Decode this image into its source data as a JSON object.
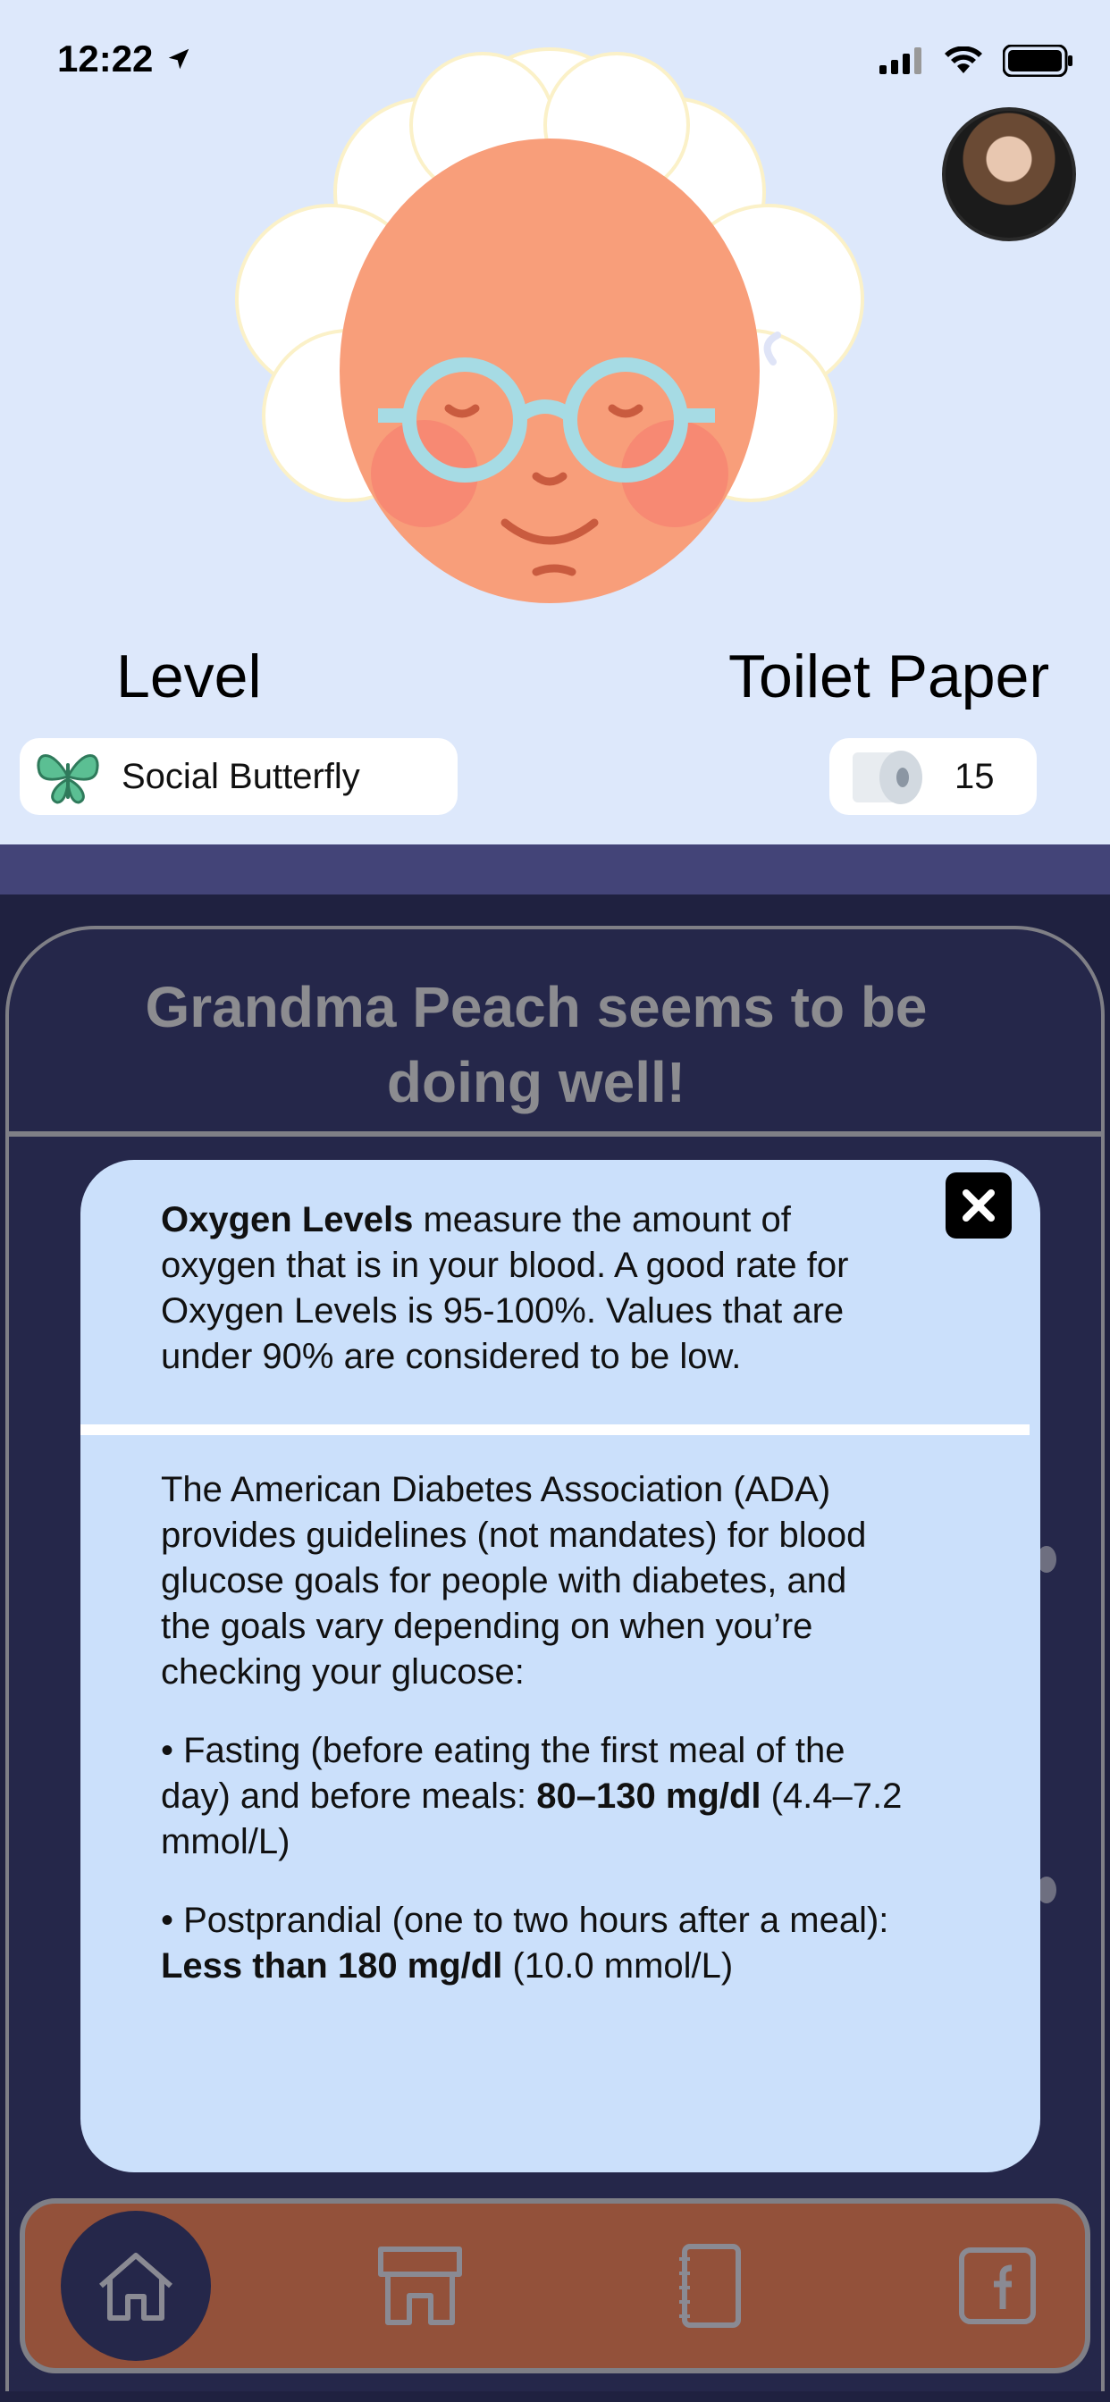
{
  "status_bar": {
    "time": "12:22",
    "icons": [
      "location-arrow-icon",
      "signal-icon",
      "wifi-icon",
      "battery-icon"
    ]
  },
  "profile": {
    "level_heading": "Level",
    "level_name": "Social Butterfly",
    "level_icon": "butterfly-icon",
    "toilet_heading": "Toilet Paper",
    "toilet_count": "15",
    "toilet_icon": "toilet-paper-icon"
  },
  "card": {
    "title_line1": "Grandma Peach seems to be",
    "title_line2": "doing well!"
  },
  "modal": {
    "oxygen_bold": "Oxygen Levels",
    "oxygen_line1_rest": " measure the amount of",
    "oxygen_line2": "oxygen that is in your blood.  A good rate for",
    "oxygen_line3": "Oxygen Levels is 95-100%.  Values that are",
    "oxygen_line4": "under 90% are considered to be low.",
    "ada_line1": "The American Diabetes Association (ADA)",
    "ada_line2": "provides guidelines (not mandates) for blood",
    "ada_line3": "glucose goals for people with diabetes, and",
    "ada_line4": "the goals vary depending on when you’re",
    "ada_line5": "checking your glucose:",
    "fasting_line1": "• Fasting (before eating the first meal of the",
    "fasting_line2_start": "day) and before meals: ",
    "fasting_bold": "80–130 mg/dl",
    "fasting_line2_end": " (4.4–7.2",
    "fasting_line3": "mmol/L)",
    "post_line1": "• Postprandial (one to two hours after a meal):",
    "post_bold": "Less than 180 mg/dl",
    "post_rest": " (10.0 mmol/L)",
    "close_icon": "close-icon"
  },
  "nav": {
    "items": [
      "home-icon",
      "store-icon",
      "notebook-icon",
      "facebook-icon"
    ]
  },
  "colors": {
    "top_bg": "#dde8fb",
    "card_bg": "#25274a",
    "modal_bg": "#cbe0fb",
    "nav_bg": "#93513a",
    "band": "#434478"
  }
}
